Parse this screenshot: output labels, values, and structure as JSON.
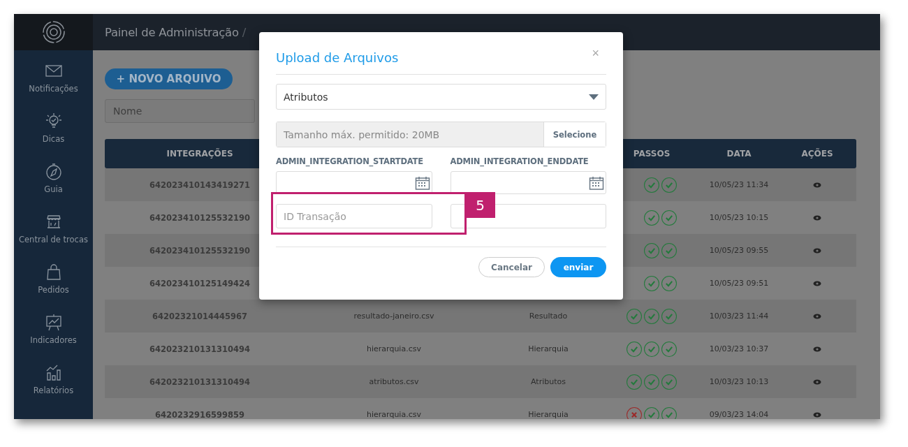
{
  "header": {
    "title": "Painel de Administração",
    "separator": "/"
  },
  "sidebar": {
    "items": [
      {
        "label": "Notificações"
      },
      {
        "label": "Dicas"
      },
      {
        "label": "Guia"
      },
      {
        "label": "Central de trocas"
      },
      {
        "label": "Pedidos"
      },
      {
        "label": "Indicadores"
      },
      {
        "label": "Relatórios"
      }
    ]
  },
  "toolbar": {
    "new_button": "+ NOVO ARQUIVO",
    "filter_placeholder": "Nome"
  },
  "table": {
    "columns": [
      {
        "label": "INTEGRAÇÕES"
      },
      {},
      {},
      {
        "label": "PASSOS"
      },
      {
        "label": "DATA"
      },
      {
        "label": "AÇÕES"
      }
    ],
    "rows": [
      {
        "id": "642023410143419271",
        "steps": [
          {
            "failed": false
          },
          {
            "failed": false
          }
        ],
        "date": "10/05/23 11:34"
      },
      {
        "id": "642023410125532190",
        "steps": [
          {
            "failed": false
          },
          {
            "failed": false
          }
        ],
        "date": "10/05/23 10:15"
      },
      {
        "id": "642023410125532190",
        "steps": [
          {
            "failed": false
          },
          {
            "failed": false
          }
        ],
        "date": "10/05/23 09:55"
      },
      {
        "id": "642023410125149424",
        "steps": [
          {
            "failed": false
          },
          {
            "failed": false
          }
        ],
        "date": "10/05/23 09:51"
      },
      {
        "id": "64202321014445967",
        "file": "resultado-janeiro.csv",
        "type": "Resultado",
        "steps": [
          {
            "failed": false
          },
          {
            "failed": false
          },
          {
            "failed": false
          }
        ],
        "date": "10/03/23 11:44"
      },
      {
        "id": "642023210131310494",
        "file": "hierarquia.csv",
        "type": "Hierarquia",
        "steps": [
          {
            "failed": false
          },
          {
            "failed": false
          },
          {
            "failed": false
          }
        ],
        "date": "10/03/23 10:37"
      },
      {
        "id": "642023210131310494",
        "file": "atributos.csv",
        "type": "Atributos",
        "steps": [
          {
            "failed": false
          },
          {
            "failed": false
          },
          {
            "failed": false
          }
        ],
        "date": "10/03/23 10:13"
      },
      {
        "id": "6420232916599859",
        "file": "hierarquia.csv",
        "type": "Hierarquia",
        "steps": [
          {
            "failed": true
          },
          {
            "failed": false
          },
          {
            "failed": false
          }
        ],
        "date": "09/03/23 14:04"
      }
    ]
  },
  "modal": {
    "title": "Upload de Arquivos",
    "close": "×",
    "type_select": "Atributos",
    "file_hint": "Tamanho máx. permitido: 20MB",
    "file_button": "Selecione",
    "start_label": "ADMIN_INTEGRATION_STARTDATE",
    "end_label": "ADMIN_INTEGRATION_ENDDATE",
    "transaction_placeholder": "ID Transação",
    "cancel": "Cancelar",
    "submit": "enviar"
  },
  "annotation": {
    "number": "5"
  }
}
